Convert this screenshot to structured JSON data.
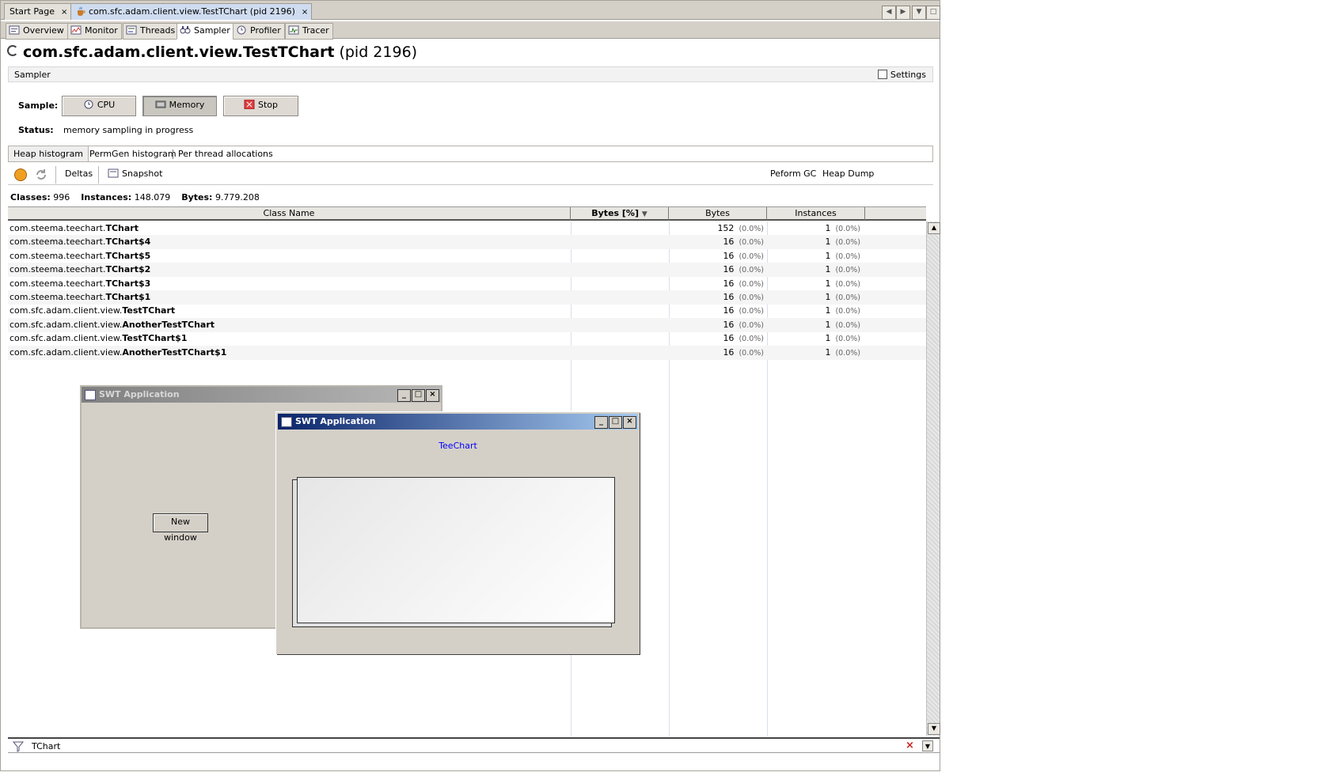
{
  "doc_tabs": [
    {
      "label": "Start Page",
      "close": "×"
    },
    {
      "label": "com.sfc.adam.client.view.TestTChart (pid 2196)",
      "close": "×"
    }
  ],
  "nav_buttons": [
    "◀",
    "▶",
    "▼",
    "□"
  ],
  "sub_tabs": [
    "Overview",
    "Monitor",
    "Threads",
    "Sampler",
    "Profiler",
    "Tracer"
  ],
  "app_title": {
    "main": "com.sfc.adam.client.view.TestTChart",
    "pid": "(pid 2196)"
  },
  "sampler_label": "Sampler",
  "settings_label": "Settings",
  "sample_label": "Sample:",
  "buttons": {
    "cpu": "CPU",
    "memory": "Memory",
    "stop": "Stop"
  },
  "status_label": "Status:",
  "status_value": "memory sampling in progress",
  "heap_tabs": [
    "Heap histogram",
    "PermGen histogram",
    "Per thread allocations"
  ],
  "tools": {
    "deltas": "Deltas",
    "snapshot": "Snapshot",
    "perform_gc": "Peform GC",
    "heap_dump": "Heap Dump"
  },
  "stats": {
    "classes_label": "Classes:",
    "classes": "996",
    "instances_label": "Instances:",
    "instances": "148.079",
    "bytes_label": "Bytes:",
    "bytes": "9.779.208"
  },
  "columns": [
    "Class Name",
    "Bytes [%]",
    "Bytes",
    "Instances"
  ],
  "sort_indicator": "▼",
  "rows": [
    {
      "pkg": "com.steema.teechart.",
      "cls": "TChart",
      "bytes": "152",
      "bytes_pct": "(0.0%)",
      "inst": "1",
      "inst_pct": "(0.0%)"
    },
    {
      "pkg": "com.steema.teechart.",
      "cls": "TChart$4",
      "bytes": "16",
      "bytes_pct": "(0.0%)",
      "inst": "1",
      "inst_pct": "(0.0%)"
    },
    {
      "pkg": "com.steema.teechart.",
      "cls": "TChart$5",
      "bytes": "16",
      "bytes_pct": "(0.0%)",
      "inst": "1",
      "inst_pct": "(0.0%)"
    },
    {
      "pkg": "com.steema.teechart.",
      "cls": "TChart$2",
      "bytes": "16",
      "bytes_pct": "(0.0%)",
      "inst": "1",
      "inst_pct": "(0.0%)"
    },
    {
      "pkg": "com.steema.teechart.",
      "cls": "TChart$3",
      "bytes": "16",
      "bytes_pct": "(0.0%)",
      "inst": "1",
      "inst_pct": "(0.0%)"
    },
    {
      "pkg": "com.steema.teechart.",
      "cls": "TChart$1",
      "bytes": "16",
      "bytes_pct": "(0.0%)",
      "inst": "1",
      "inst_pct": "(0.0%)"
    },
    {
      "pkg": "com.sfc.adam.client.view.",
      "cls": "TestTChart",
      "bytes": "16",
      "bytes_pct": "(0.0%)",
      "inst": "1",
      "inst_pct": "(0.0%)"
    },
    {
      "pkg": "com.sfc.adam.client.view.",
      "cls": "AnotherTestTChart",
      "bytes": "16",
      "bytes_pct": "(0.0%)",
      "inst": "1",
      "inst_pct": "(0.0%)"
    },
    {
      "pkg": "com.sfc.adam.client.view.",
      "cls": "TestTChart$1",
      "bytes": "16",
      "bytes_pct": "(0.0%)",
      "inst": "1",
      "inst_pct": "(0.0%)"
    },
    {
      "pkg": "com.sfc.adam.client.view.",
      "cls": "AnotherTestTChart$1",
      "bytes": "16",
      "bytes_pct": "(0.0%)",
      "inst": "1",
      "inst_pct": "(0.0%)"
    }
  ],
  "filter_value": "TChart",
  "swt_back": {
    "title": "SWT Application",
    "button": "New window"
  },
  "swt_front": {
    "title": "SWT Application",
    "chart_title": "TeeChart"
  },
  "window_buttons": {
    "min": "_",
    "max": "□",
    "close": "×"
  },
  "scroll_arrows": {
    "up": "▲",
    "down": "▼"
  },
  "colors": {
    "accent_tab": "#cfdcf0",
    "swt_active_title": "#0a246a",
    "teechart_title": "#0000ff",
    "stop_icon": "#e04040"
  }
}
